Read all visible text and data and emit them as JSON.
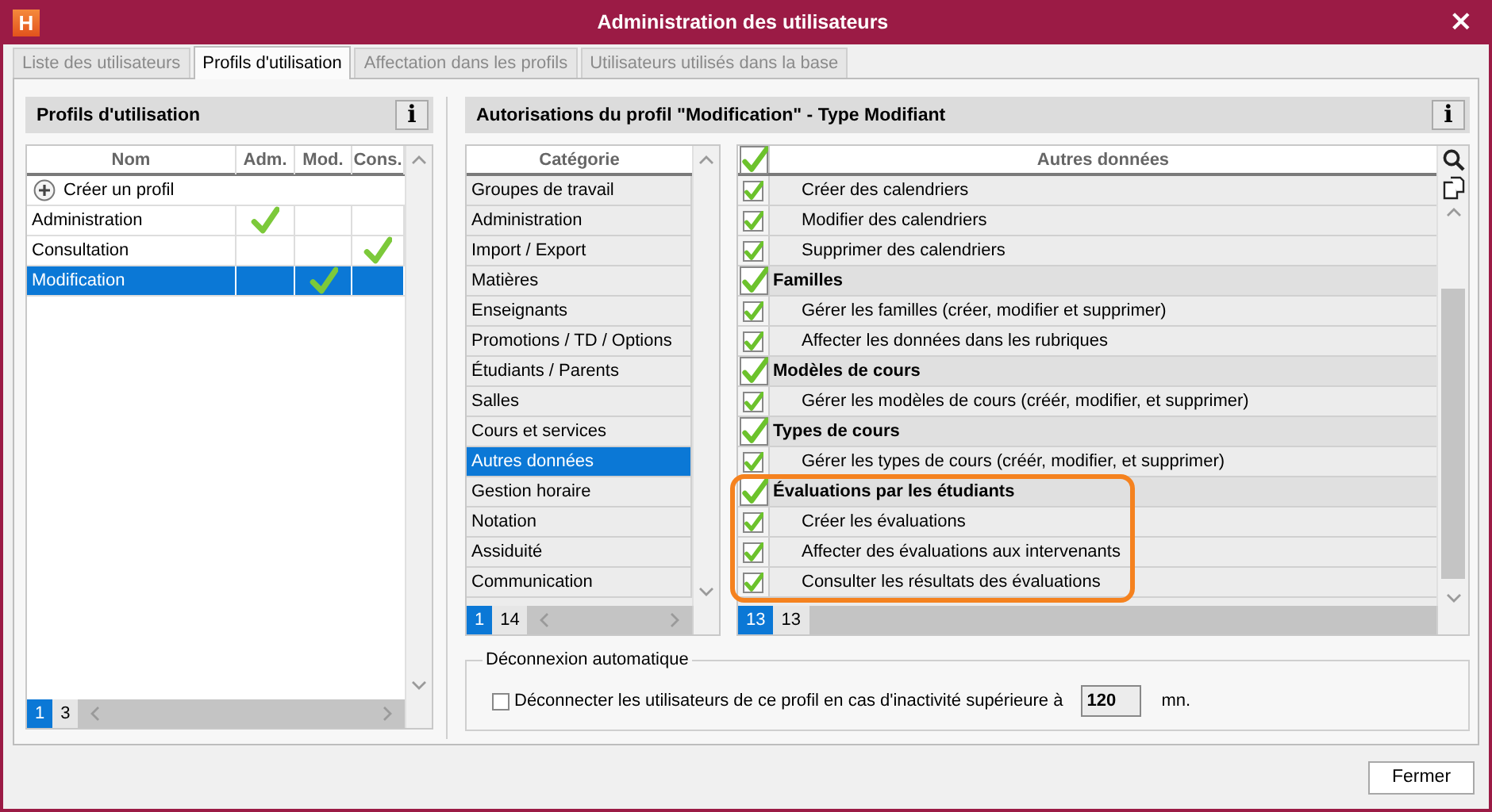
{
  "window": {
    "logo": "H",
    "title": "Administration des utilisateurs",
    "close": "×"
  },
  "tabs": [
    {
      "label": "Liste des utilisateurs",
      "selected": false
    },
    {
      "label": "Profils d'utilisation",
      "selected": true
    },
    {
      "label": "Affectation dans les profils",
      "selected": false
    },
    {
      "label": "Utilisateurs utilisés dans la base",
      "selected": false
    }
  ],
  "profiles": {
    "title": "Profils d'utilisation",
    "info_button": "i",
    "columns": [
      "Nom",
      "Adm.",
      "Mod.",
      "Cons."
    ],
    "create_label": "Créer un profil",
    "rows": [
      {
        "name": "Administration",
        "adm": true,
        "mod": false,
        "cons": false,
        "selected": false
      },
      {
        "name": "Consultation",
        "adm": false,
        "mod": false,
        "cons": true,
        "selected": false
      },
      {
        "name": "Modification",
        "adm": false,
        "mod": true,
        "cons": false,
        "selected": true
      }
    ],
    "pager": {
      "current": "1",
      "total": "3"
    }
  },
  "permissions": {
    "title": "Autorisations du profil \"Modification\" - Type Modifiant",
    "info_button": "i",
    "category_header": "Catégorie",
    "categories": [
      {
        "label": "Groupes de travail",
        "selected": false
      },
      {
        "label": "Administration",
        "selected": false
      },
      {
        "label": "Import / Export",
        "selected": false
      },
      {
        "label": "Matières",
        "selected": false
      },
      {
        "label": "Enseignants",
        "selected": false
      },
      {
        "label": "Promotions / TD / Options",
        "selected": false
      },
      {
        "label": "Étudiants / Parents",
        "selected": false
      },
      {
        "label": "Salles",
        "selected": false
      },
      {
        "label": "Cours et services",
        "selected": false
      },
      {
        "label": "Autres données",
        "selected": true
      },
      {
        "label": "Gestion horaire",
        "selected": false
      },
      {
        "label": "Notation",
        "selected": false
      },
      {
        "label": "Assiduité",
        "selected": false
      },
      {
        "label": "Communication",
        "selected": false
      }
    ],
    "category_pager": {
      "current": "1",
      "total": "14"
    },
    "items_header": "Autres données",
    "all_checked": true,
    "items": [
      {
        "kind": "item",
        "label": "Créer des calendriers",
        "checked": true,
        "highlighted": false
      },
      {
        "kind": "item",
        "label": "Modifier des calendriers",
        "checked": true,
        "highlighted": false
      },
      {
        "kind": "item",
        "label": "Supprimer des calendriers",
        "checked": true,
        "highlighted": false
      },
      {
        "kind": "group",
        "label": "Familles",
        "checked": true,
        "highlighted": false
      },
      {
        "kind": "item",
        "label": "Gérer les familles (créer, modifier et supprimer)",
        "checked": true,
        "highlighted": false
      },
      {
        "kind": "item",
        "label": "Affecter les données dans les rubriques",
        "checked": true,
        "highlighted": false
      },
      {
        "kind": "group",
        "label": "Modèles de cours",
        "checked": true,
        "highlighted": false
      },
      {
        "kind": "item",
        "label": "Gérer les modèles de cours (créér, modifier, et supprimer)",
        "checked": true,
        "highlighted": false
      },
      {
        "kind": "group",
        "label": "Types de cours",
        "checked": true,
        "highlighted": false
      },
      {
        "kind": "item",
        "label": "Gérer les types de cours (créér, modifier, et supprimer)",
        "checked": true,
        "highlighted": false
      },
      {
        "kind": "group",
        "label": "Évaluations par les étudiants",
        "checked": true,
        "highlighted": true
      },
      {
        "kind": "item",
        "label": "Créer les évaluations",
        "checked": true,
        "highlighted": true
      },
      {
        "kind": "item",
        "label": "Affecter des évaluations aux intervenants",
        "checked": true,
        "highlighted": true
      },
      {
        "kind": "item",
        "label": "Consulter les résultats des évaluations",
        "checked": true,
        "highlighted": true
      }
    ],
    "items_pager": {
      "current": "13",
      "total": "13"
    }
  },
  "auto_logout": {
    "legend": "Déconnexion automatique",
    "checked": false,
    "label": "Déconnecter les utilisateurs de ce profil en cas d'inactivité supérieure à",
    "value": "120",
    "unit": "mn."
  },
  "close_button": "Fermer"
}
